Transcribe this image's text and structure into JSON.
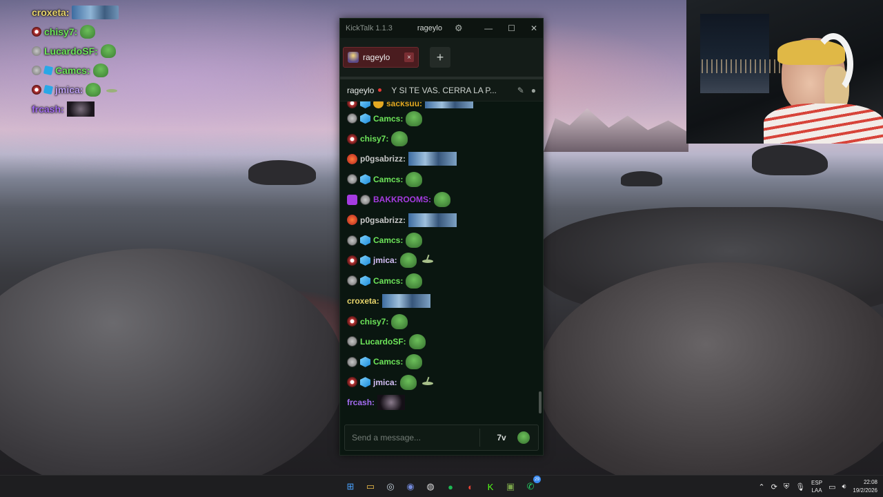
{
  "overlay_chat": [
    {
      "user": "croxeta:",
      "color": "#e6d36a",
      "badges": [],
      "emotes": [
        "wide"
      ]
    },
    {
      "user": "chisy7:",
      "color": "#6ee65a",
      "badges": [
        "mouth"
      ],
      "emotes": [
        "frog"
      ]
    },
    {
      "user": "LucardoSF:",
      "color": "#6ee65a",
      "badges": [
        "gray"
      ],
      "emotes": [
        "frog"
      ]
    },
    {
      "user": "Camcs:",
      "color": "#6ee65a",
      "badges": [
        "gray",
        "sub"
      ],
      "emotes": [
        "frog"
      ]
    },
    {
      "user": "jmica:",
      "color": "#b99cf0",
      "badges": [
        "mouth",
        "sub"
      ],
      "emotes": [
        "frog",
        "ant"
      ]
    },
    {
      "user": "frcash:",
      "color": "#a36cf0",
      "badges": [],
      "emotes": [
        "dark"
      ]
    }
  ],
  "app": {
    "title": "KickTalk 1.1.3",
    "user": "rageylo",
    "tab_label": "rageylo",
    "tab_close": "×",
    "tab_add": "+",
    "window_min": "—",
    "window_max": "☐",
    "window_close": "✕",
    "pinned_channel": "rageylo",
    "pinned_title": "Y SI TE VAS. CERRA LA P...",
    "input_placeholder": "Send a message...",
    "seventv_label": "7v"
  },
  "messages": [
    {
      "user": "sacksuu:",
      "color": "#e3a822",
      "badges": [
        "mouthg",
        "sub",
        "gold"
      ],
      "emotes": [
        "wide"
      ],
      "partial": true
    },
    {
      "user": "Camcs:",
      "color": "#6ee65a",
      "badges": [
        "gray",
        "sub"
      ],
      "emotes": [
        "frog"
      ]
    },
    {
      "user": "chisy7:",
      "color": "#6ee65a",
      "badges": [
        "mouth"
      ],
      "emotes": [
        "frog"
      ]
    },
    {
      "user": "p0gsabrizz:",
      "color": "#c7c7c7",
      "badges": [
        "red"
      ],
      "emotes": [
        "wide"
      ]
    },
    {
      "user": "Camcs:",
      "color": "#6ee65a",
      "badges": [
        "gray",
        "sub"
      ],
      "emotes": [
        "frog"
      ]
    },
    {
      "user": "BAKKROOMS:",
      "color": "#a53be0",
      "badges": [
        "purple",
        "gray"
      ],
      "emotes": [
        "frog"
      ]
    },
    {
      "user": "p0gsabrizz:",
      "color": "#c7c7c7",
      "badges": [
        "red"
      ],
      "emotes": [
        "wide"
      ]
    },
    {
      "user": "Camcs:",
      "color": "#6ee65a",
      "badges": [
        "gray",
        "sub"
      ],
      "emotes": [
        "frog"
      ]
    },
    {
      "user": "jmica:",
      "color": "#d3bef5",
      "badges": [
        "mouth",
        "sub"
      ],
      "emotes": [
        "frog",
        "ant"
      ]
    },
    {
      "user": "Camcs:",
      "color": "#6ee65a",
      "badges": [
        "gray",
        "sub"
      ],
      "emotes": [
        "frog"
      ]
    },
    {
      "user": "croxeta:",
      "color": "#e6d36a",
      "badges": [],
      "emotes": [
        "wide"
      ]
    },
    {
      "user": "chisy7:",
      "color": "#6ee65a",
      "badges": [
        "mouth"
      ],
      "emotes": [
        "frog"
      ]
    },
    {
      "user": "LucardoSF:",
      "color": "#6ee65a",
      "badges": [
        "gray"
      ],
      "emotes": [
        "frog"
      ]
    },
    {
      "user": "Camcs:",
      "color": "#6ee65a",
      "badges": [
        "gray",
        "sub"
      ],
      "emotes": [
        "frog"
      ]
    },
    {
      "user": "jmica:",
      "color": "#d3bef5",
      "badges": [
        "mouth",
        "sub"
      ],
      "emotes": [
        "frog",
        "ant"
      ]
    },
    {
      "user": "frcash:",
      "color": "#a36cf0",
      "badges": [],
      "emotes": [
        "dark"
      ]
    }
  ],
  "taskbar": {
    "apps": [
      {
        "name": "start-icon",
        "glyph": "⊞",
        "color": "#4aa3ff"
      },
      {
        "name": "file-explorer-icon",
        "glyph": "▭",
        "color": "#f3c24b"
      },
      {
        "name": "steam-icon",
        "glyph": "◎",
        "color": "#c6d4df"
      },
      {
        "name": "discord-icon",
        "glyph": "◉",
        "color": "#7289da"
      },
      {
        "name": "obs-icon",
        "glyph": "◍",
        "color": "#dddddd"
      },
      {
        "name": "spotify-icon",
        "glyph": "●",
        "color": "#1db954"
      },
      {
        "name": "chrome-icon",
        "glyph": "◐",
        "color": "#ea4335"
      },
      {
        "name": "kick-icon",
        "glyph": "K",
        "color": "#53fc18"
      },
      {
        "name": "minecraft-icon",
        "glyph": "▣",
        "color": "#7aa34a"
      },
      {
        "name": "whatsapp-icon",
        "glyph": "✆",
        "color": "#25d366",
        "badge": "29"
      }
    ],
    "lang_top": "ESP",
    "lang_bottom": "LAA",
    "time": "22:08",
    "date": "19/2/2026"
  }
}
